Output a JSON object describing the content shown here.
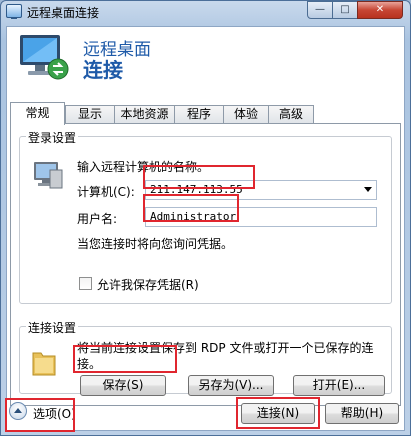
{
  "window": {
    "title": "远程桌面连接",
    "minimize_glyph": "—",
    "maximize_glyph": "□",
    "close_glyph": "✕"
  },
  "header": {
    "line1": "远程桌面",
    "line2": "连接"
  },
  "tabs": [
    {
      "label": "常规",
      "active": true
    },
    {
      "label": "显示",
      "active": false
    },
    {
      "label": "本地资源",
      "active": false
    },
    {
      "label": "程序",
      "active": false
    },
    {
      "label": "体验",
      "active": false
    },
    {
      "label": "高级",
      "active": false
    }
  ],
  "login_settings": {
    "title": "登录设置",
    "prompt": "输入远程计算机的名称。",
    "computer_label": "计算机(C):",
    "computer_value": "211.147.113.55",
    "username_label": "用户名:",
    "username_value": "Administrator",
    "credential_note": "当您连接时将向您询问凭据。",
    "save_credentials_label": "允许我保存凭据(R)",
    "save_credentials_checked": false
  },
  "connection_settings": {
    "title": "连接设置",
    "description_line1": "将当前连接设置保存到 RDP 文件或打开一个已保存的连",
    "description_line2": "接。",
    "save_button": "保存(S)",
    "save_as_button": "另存为(V)...",
    "open_button": "打开(E)..."
  },
  "footer": {
    "options_label": "选项(O)",
    "connect_button": "连接(N)",
    "help_button": "帮助(H)"
  },
  "icons": {
    "app": "remote-desktop-icon",
    "header": "remote-desktop-monitor-icon",
    "computer": "computer-icon",
    "folder": "folder-icon",
    "options_toggle": "chevron-up-icon"
  },
  "colors": {
    "highlight": "#e0262f",
    "header_text": "#1e5aa8"
  }
}
